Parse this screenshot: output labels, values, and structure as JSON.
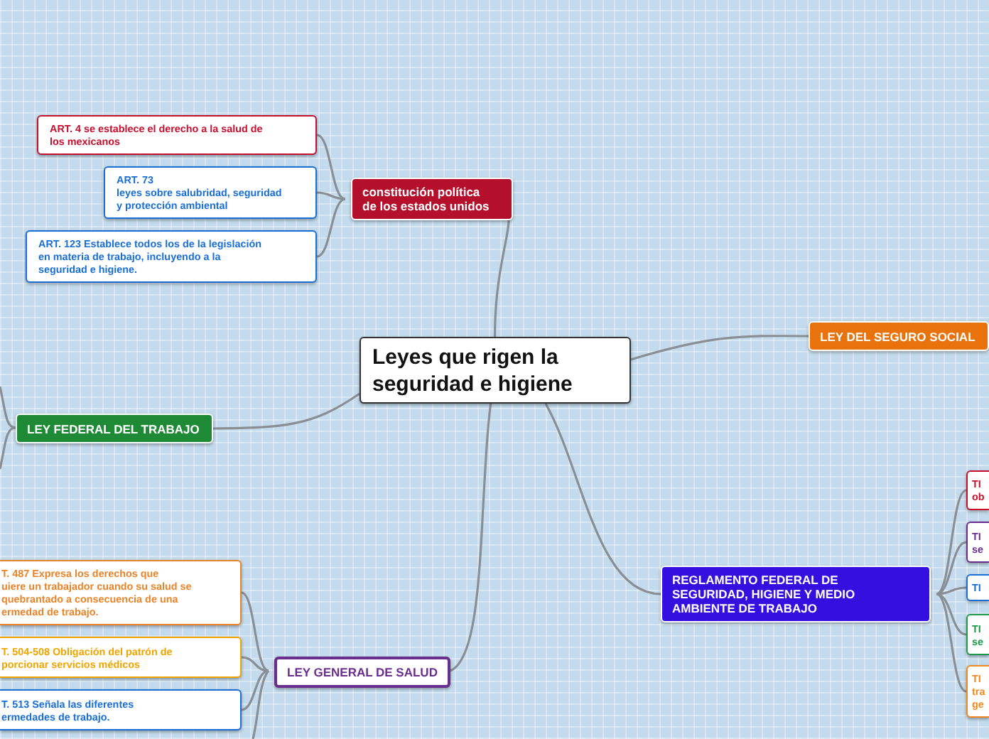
{
  "central_topic": {
    "text": "Leyes que rigen la\nseguridad e higiene"
  },
  "branches": [
    {
      "label": "constitución política\nde los estados unidos",
      "kind": "filled",
      "color": "#b5102b",
      "children": [
        {
          "text": "ART. 4 se establece el derecho a la salud de\nlos mexicanos",
          "color": "#c8102e"
        },
        {
          "text": "ART. 73\nleyes sobre salubridad, seguridad\ny protección ambiental",
          "color": "#1a6fd6"
        },
        {
          "text": "ART. 123 Establece todos los de la legislación\nen materia de trabajo, incluyendo a la\nseguridad e higiene.",
          "color": "#1a6fd6"
        }
      ]
    },
    {
      "label": "LEY FEDERAL DEL TRABAJO",
      "kind": "filled",
      "color": "#1e8a36"
    },
    {
      "label": "LEY DEL SEGURO SOCIAL",
      "kind": "filled",
      "color": "#e8720c"
    },
    {
      "label": "REGLAMENTO FEDERAL DE\nSEGURIDAD, HIGIENE Y MEDIO\nAMBIENTE DE TRABAJO",
      "kind": "filled",
      "color": "#3310e0",
      "children": [
        {
          "text": "TI\nob",
          "color": "#c8102e"
        },
        {
          "text": "TI\nse",
          "color": "#6a2e8f"
        },
        {
          "text": "TI",
          "color": "#1a6fd6"
        },
        {
          "text": "TI\nse",
          "color": "#1e9a4a"
        },
        {
          "text": "TI\ntra\nge",
          "color": "#f08a20"
        }
      ]
    },
    {
      "label": "LEY GENERAL DE SALUD",
      "kind": "outlined",
      "color": "#6a2e8f",
      "children": [
        {
          "text": "T. 487 Expresa los derechos que\nuiere un trabajador cuando su salud se\nquebrantado a consecuencia de una\nermedad de trabajo.",
          "color": "#e8842a"
        },
        {
          "text": "T. 504-508 Obligación del  patrón de\nporcionar servicios médicos",
          "color": "#f0a500"
        },
        {
          "text": "T. 513 Señala las diferentes\nermedades de trabajo.",
          "color": "#1a6fd6"
        }
      ]
    }
  ]
}
